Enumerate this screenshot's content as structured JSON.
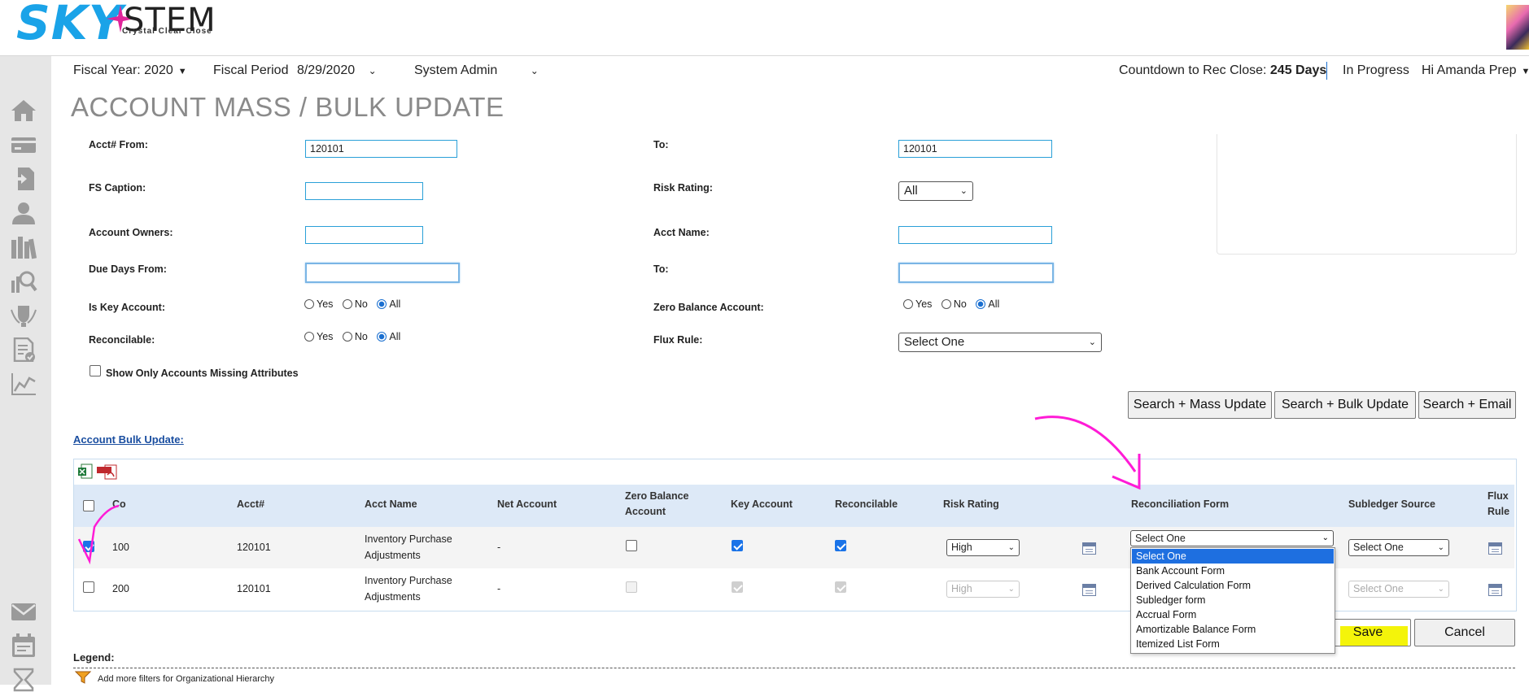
{
  "logo": {
    "sky": "SKY",
    "stem": "STEM",
    "tagline": "Crystal Clear Close"
  },
  "header": {
    "fiscal_year": "Fiscal Year: 2020",
    "fiscal_period_label": "Fiscal Period",
    "fiscal_period_value": "8/29/2020",
    "role": "System Admin",
    "countdown_label": "Countdown to Rec Close:",
    "countdown_value": "245 Days",
    "status": "In Progress",
    "greeting": "Hi Amanda Prep"
  },
  "page_title": "ACCOUNT MASS / BULK UPDATE",
  "form": {
    "acct_from_label": "Acct# From:",
    "acct_from_value": "120101",
    "acct_to_label": "To:",
    "acct_to_value": "120101",
    "fs_caption_label": "FS Caption:",
    "fs_caption_value": "",
    "risk_rating_label": "Risk Rating:",
    "risk_rating_value": "All",
    "account_owners_label": "Account Owners:",
    "account_owners_value": "",
    "acct_name_label": "Acct Name:",
    "acct_name_value": "",
    "due_days_from_label": "Due Days From:",
    "due_days_from_value": "",
    "due_days_to_label": "To:",
    "due_days_to_value": "",
    "is_key_label": "Is Key Account:",
    "zero_balance_label": "Zero Balance Account:",
    "reconcilable_label": "Reconcilable:",
    "flux_rule_label": "Flux Rule:",
    "flux_rule_value": "Select One",
    "radio_yes": "Yes",
    "radio_no": "No",
    "radio_all": "All",
    "missing_attr_label": "Show Only Accounts Missing Attributes"
  },
  "buttons": {
    "search_mass": "Search + Mass Update",
    "search_bulk": "Search + Bulk Update",
    "search_email": "Search + Email",
    "save": "Save",
    "cancel": "Cancel"
  },
  "bulk_link": "Account Bulk Update:",
  "table": {
    "headers": {
      "co": "Co",
      "acct": "Acct#",
      "acct_name": "Acct Name",
      "net_account": "Net Account",
      "zero_balance_1": "Zero Balance",
      "zero_balance_2": "Account",
      "key_account": "Key Account",
      "reconcilable": "Reconcilable",
      "risk_rating": "Risk Rating",
      "reconciliation_form": "Reconciliation Form",
      "subledger_source": "Subledger Source",
      "flux_1": "Flux",
      "flux_2": "Rule"
    },
    "rows": [
      {
        "co": "100",
        "acct": "120101",
        "name_1": "Inventory Purchase",
        "name_2": "Adjustments",
        "net": "-",
        "risk": "High",
        "recon_form": "Select One",
        "subledger": "Select One"
      },
      {
        "co": "200",
        "acct": "120101",
        "name_1": "Inventory Purchase",
        "name_2": "Adjustments",
        "net": "-",
        "risk": "High",
        "recon_form": "",
        "subledger": "Select One"
      }
    ]
  },
  "recon_form_options": [
    "Select One",
    "Bank Account Form",
    "Derived Calculation Form",
    "Subledger form",
    "Accrual Form",
    "Amortizable Balance Form",
    "Itemized List Form"
  ],
  "legend": {
    "title": "Legend:",
    "filter_hint": "Add more filters for Organizational Hierarchy"
  },
  "colors": {
    "brand_blue": "#1aa3e8",
    "brand_magenta": "#e0249a",
    "annotation": "#ff1bd6",
    "highlight": "#f4f40a",
    "dropdown_selected": "#1e6fe0"
  },
  "icons": [
    "home-icon",
    "card-icon",
    "document-transfer-icon",
    "user-icon",
    "library-icon",
    "search-report-icon",
    "award-icon",
    "checklist-icon",
    "line-chart-icon",
    "mail-icon",
    "calendar-icon",
    "hourglass-icon",
    "excel-icon",
    "pdf-icon",
    "funnel-icon"
  ]
}
